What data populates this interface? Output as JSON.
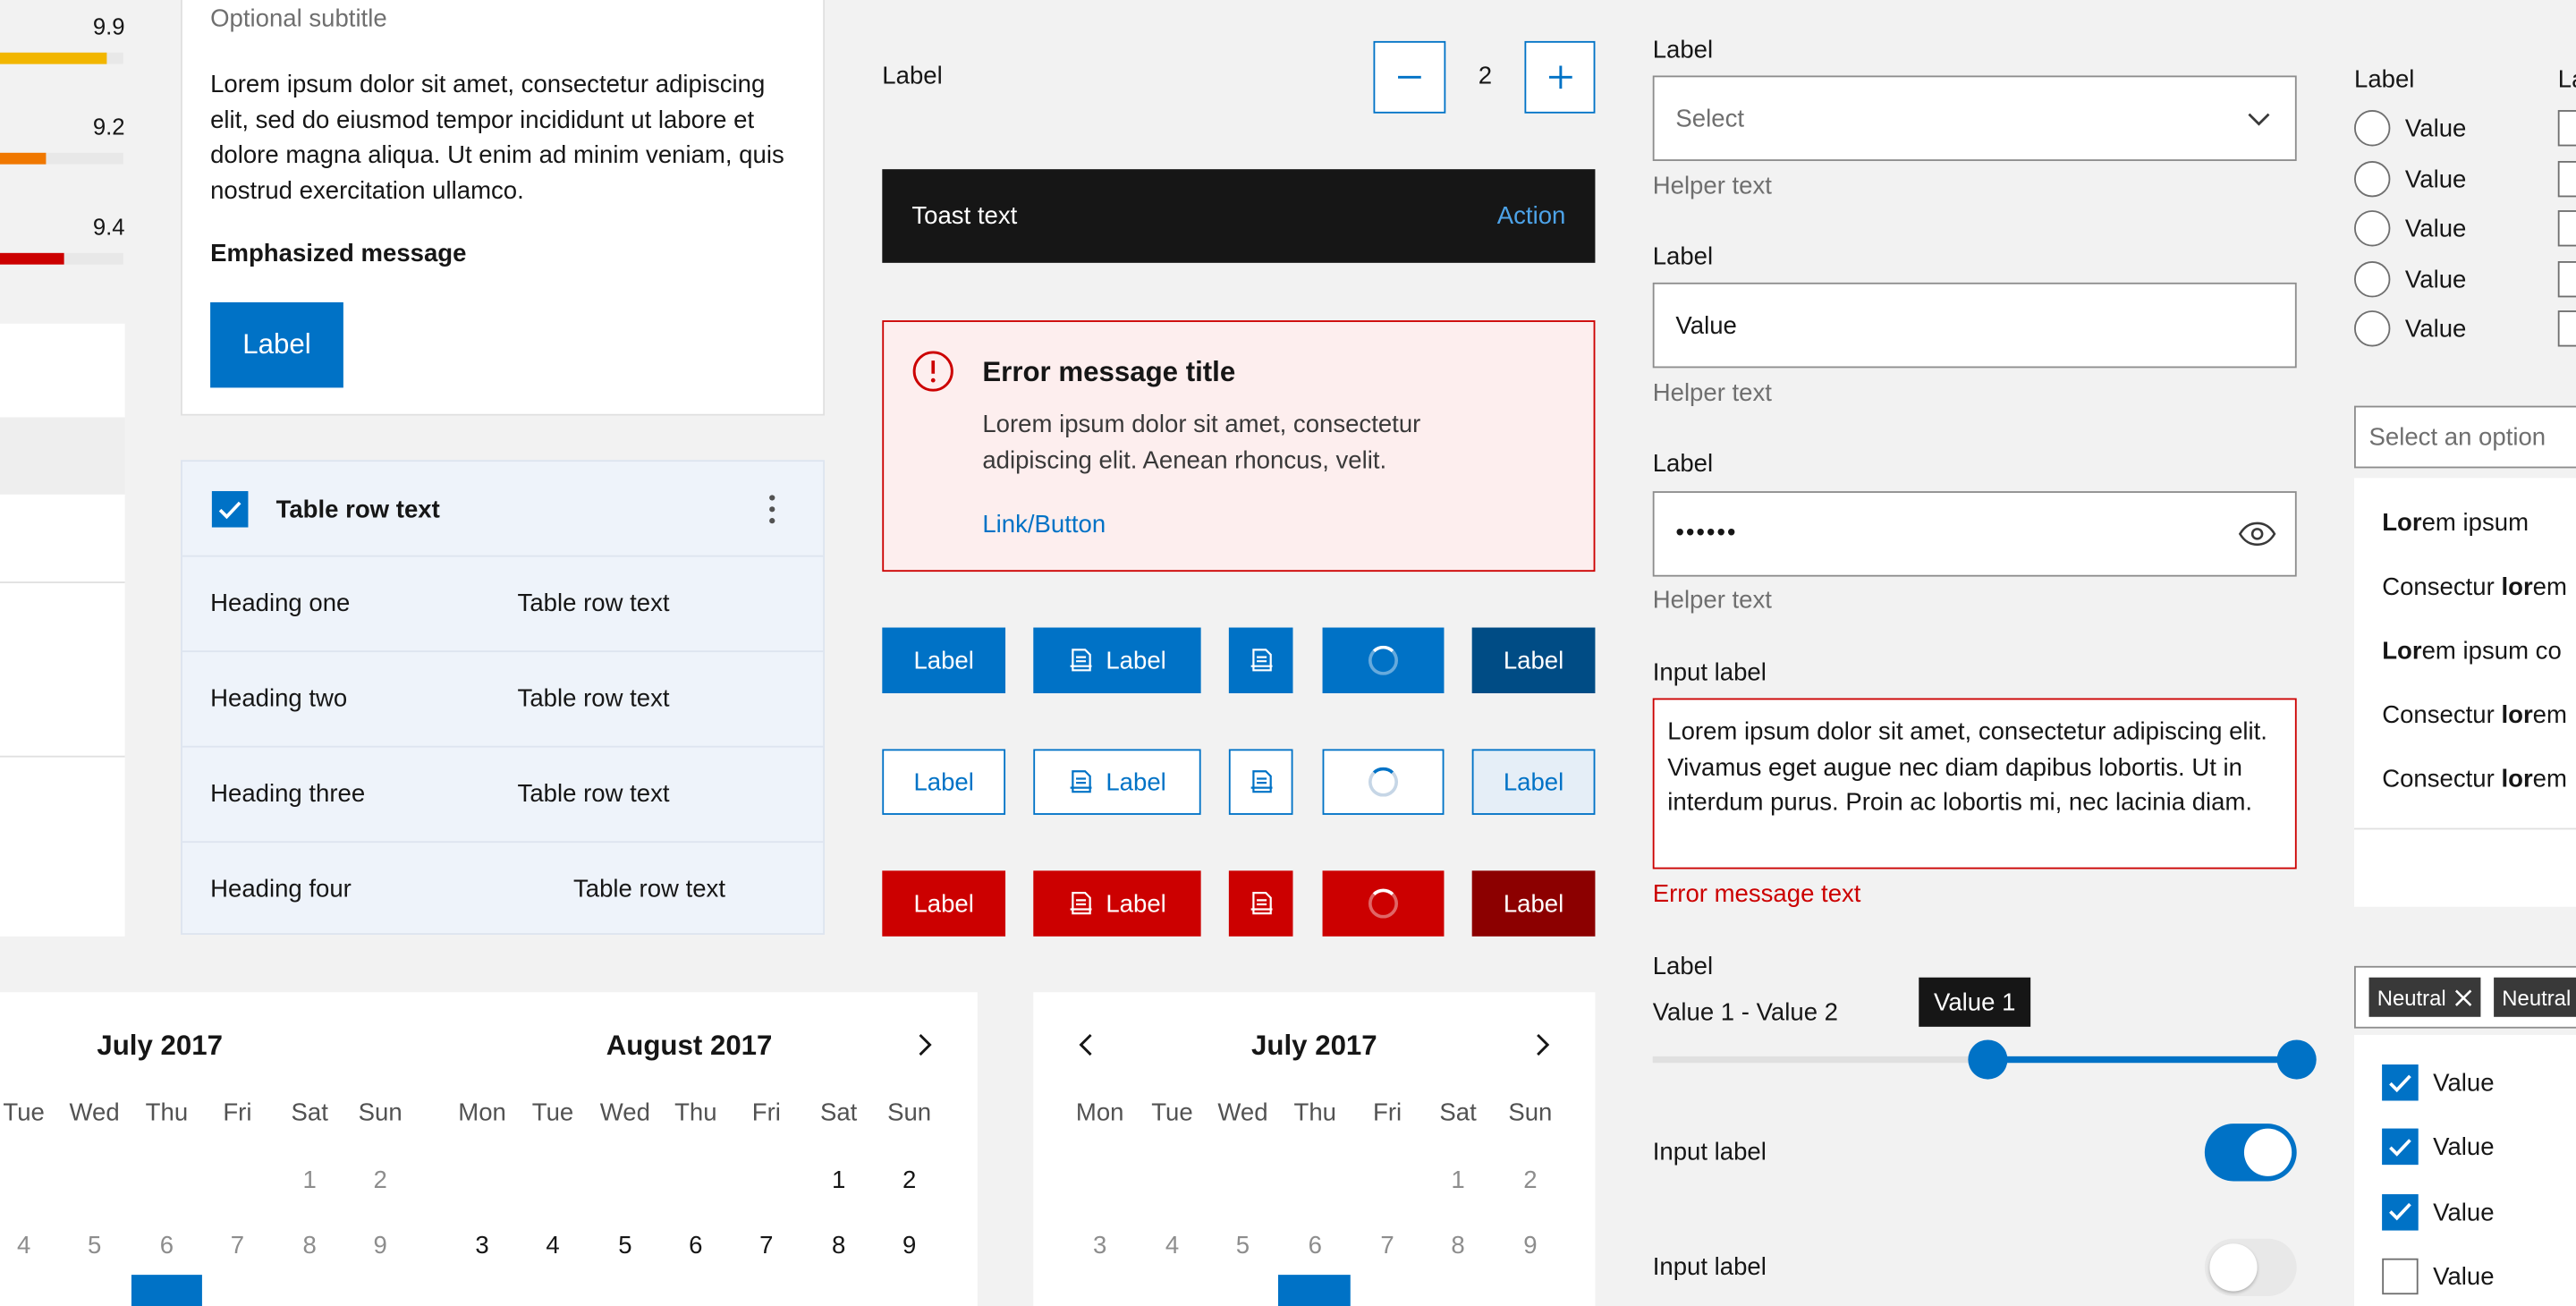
{
  "ratings": [
    {
      "value": "9.9",
      "fraction": 0.87,
      "color": "#f2b600"
    },
    {
      "value": "9.2",
      "fraction": 0.37,
      "color": "#f07800"
    },
    {
      "value": "9.4",
      "fraction": 0.52,
      "color": "#cc0000"
    }
  ],
  "card": {
    "subtitle": "Optional subtitle",
    "body": "Lorem ipsum dolor sit amet, consectetur adipiscing elit, sed do eiusmod tempor incididunt ut labore et dolore magna aliqua. Ut enim ad minim veniam, quis nostrud exercitation ullamco.",
    "emphasis": "Emphasized message",
    "button": "Label"
  },
  "table": {
    "header": "Table row text",
    "rows": [
      {
        "heading": "Heading one",
        "text": "Table row text"
      },
      {
        "heading": "Heading two",
        "text": "Table row text"
      },
      {
        "heading": "Heading three",
        "text": "Table row text"
      },
      {
        "heading": "Heading four",
        "text": "Table row text"
      }
    ]
  },
  "stepper": {
    "label": "Label",
    "value": "2",
    "minus": "−",
    "plus": "+"
  },
  "toast": {
    "text": "Toast text",
    "action": "Action"
  },
  "error": {
    "title": "Error message title",
    "body": "Lorem ipsum dolor sit amet, consectetur adipiscing elit. Aenean rhoncus, velit.",
    "link": "Link/Button"
  },
  "buttons": {
    "label": "Label"
  },
  "select": {
    "label": "Label",
    "placeholder": "Select",
    "helper": "Helper text"
  },
  "text_input": {
    "label": "Label",
    "value": "Value",
    "helper": "Helper text"
  },
  "password": {
    "label": "Label",
    "value": "••••••",
    "helper": "Helper text"
  },
  "textarea": {
    "label": "Input label",
    "value": "Lorem ipsum dolor sit amet, consectetur adipiscing elit. Vivamus eget augue nec diam dapibus lobortis. Ut in interdum purus. Proin ac lobortis mi, nec lacinia diam.",
    "error": "Error message text"
  },
  "slider": {
    "label": "Label",
    "range_text": "Value 1 - Value 2",
    "tooltip": "Value 1",
    "low": 0.5,
    "high": 1.0
  },
  "toggles": [
    {
      "label": "Input label",
      "on": true
    },
    {
      "label": "Input label",
      "on": false
    }
  ],
  "radios": {
    "label": "Label",
    "items": [
      "Value",
      "Value",
      "Value",
      "Value",
      "Value"
    ]
  },
  "checkcol": {
    "label": "La"
  },
  "combo": {
    "placeholder": "Select an option",
    "options": [
      {
        "bold": "Lor",
        "rest": "em ipsum"
      },
      {
        "rest": "Consectur ",
        "bold2": "lor",
        "rest2": "em"
      },
      {
        "bold": "Lor",
        "rest": "em ipsum co"
      },
      {
        "rest": "Consectur ",
        "bold2": "lor",
        "rest2": "em"
      },
      {
        "rest": "Consectur ",
        "bold2": "lor",
        "rest2": "em"
      }
    ]
  },
  "tags": [
    "Neutral",
    "Neutral"
  ],
  "checklist": [
    {
      "label": "Value",
      "checked": true
    },
    {
      "label": "Value",
      "checked": true
    },
    {
      "label": "Value",
      "checked": true
    },
    {
      "label": "Value",
      "checked": false
    }
  ],
  "calendar_left": {
    "months": [
      "July 2017",
      "August 2017"
    ],
    "dow_left": [
      "Tue",
      "Wed",
      "Thu",
      "Fri",
      "Sat",
      "Sun"
    ],
    "dow_right": [
      "Mon",
      "Tue",
      "Wed",
      "Thu",
      "Fri",
      "Sat",
      "Sun"
    ],
    "week1_left": [
      "1",
      "2"
    ],
    "week2_left": [
      "4",
      "5",
      "6",
      "7",
      "8",
      "9"
    ],
    "week1_right": [
      "1",
      "2"
    ],
    "week2_right": [
      "3",
      "4",
      "5",
      "6",
      "7",
      "8",
      "9"
    ]
  },
  "calendar_right": {
    "month": "July 2017",
    "dow": [
      "Mon",
      "Tue",
      "Wed",
      "Thu",
      "Fri",
      "Sat",
      "Sun"
    ],
    "week1": [
      "1",
      "2"
    ],
    "week2": [
      "3",
      "4",
      "5",
      "6",
      "7",
      "8",
      "9"
    ]
  },
  "colors": {
    "primary": "#0072c6",
    "danger": "#cc0000",
    "error_bg": "#fdeeee"
  }
}
